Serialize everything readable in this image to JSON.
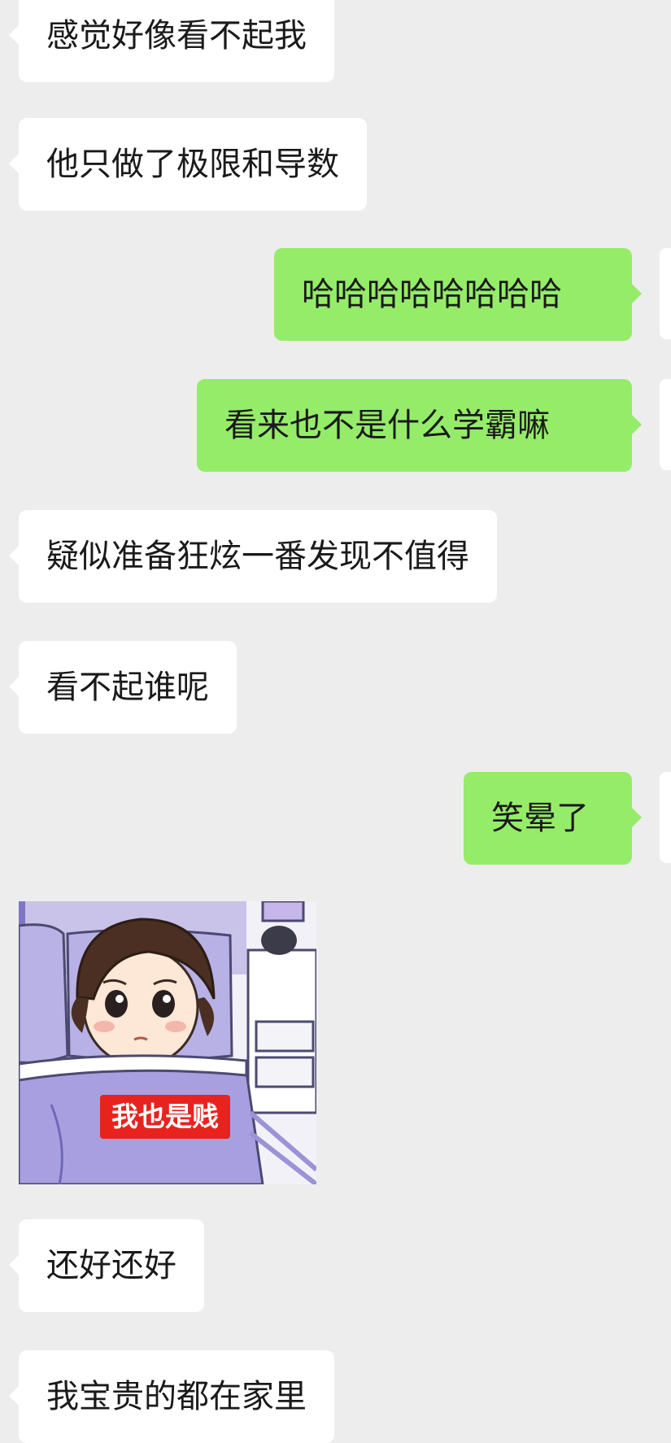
{
  "messages": [
    {
      "side": "left",
      "text": "感觉好像看不起我"
    },
    {
      "side": "left",
      "text": "他只做了极限和导数"
    },
    {
      "side": "right",
      "text": "哈哈哈哈哈哈哈哈"
    },
    {
      "side": "right",
      "text": "看来也不是什么学霸嘛"
    },
    {
      "side": "left",
      "text": "疑似准备狂炫一番发现不值得"
    },
    {
      "side": "left",
      "text": "看不起谁呢"
    },
    {
      "side": "right",
      "text": "笑晕了"
    },
    {
      "side": "left",
      "type": "sticker",
      "caption": "我也是贱"
    },
    {
      "side": "left",
      "text": "还好还好"
    },
    {
      "side": "left",
      "text": "我宝贵的都在家里"
    }
  ],
  "colors": {
    "background": "#ededed",
    "incoming_bubble": "#ffffff",
    "outgoing_bubble": "#95ec69",
    "sticker_caption": "#e8231e"
  }
}
